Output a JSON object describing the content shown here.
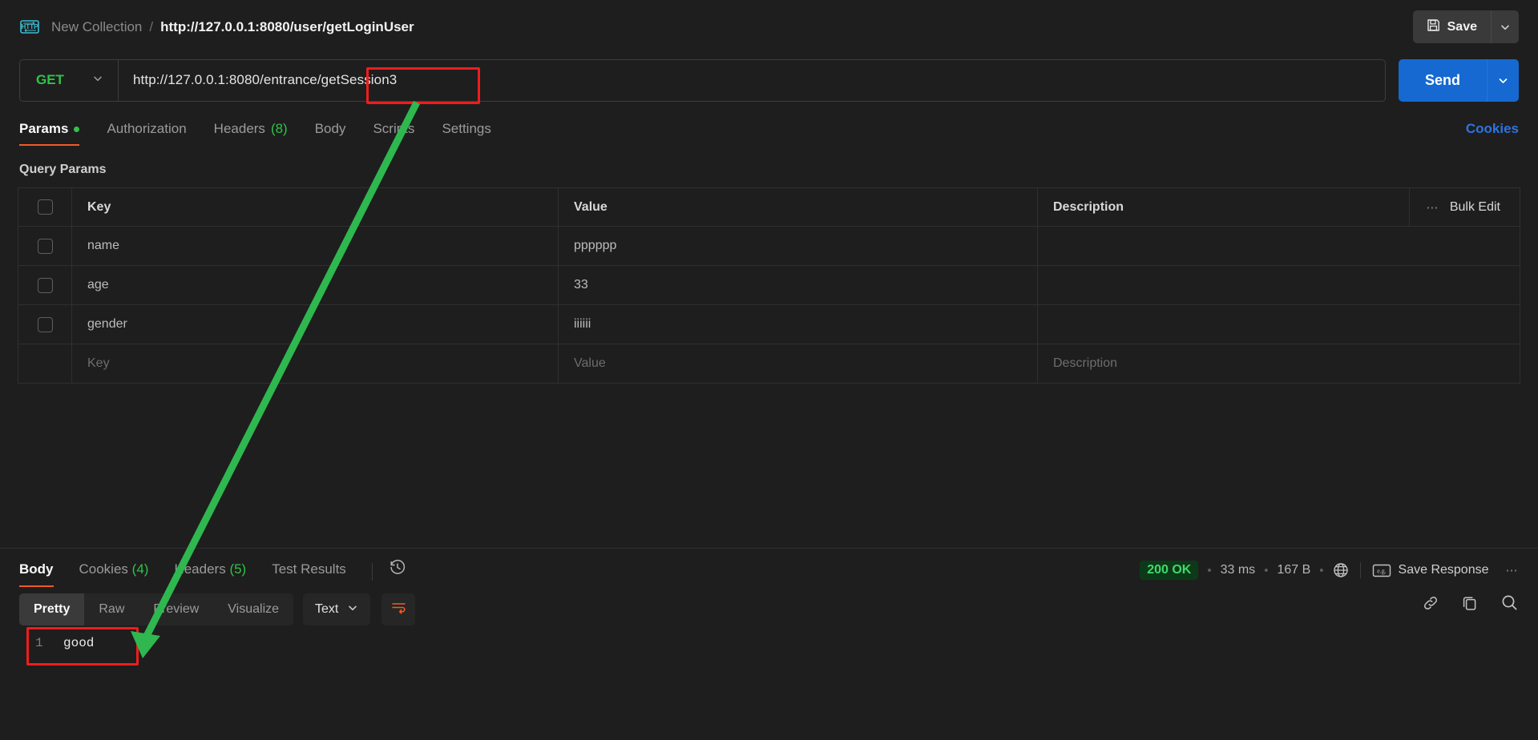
{
  "app": {
    "breadcrumb": {
      "collection": "New Collection",
      "separator": "/",
      "current": "http://127.0.0.1:8080/user/getLoginUser"
    },
    "save_label": "Save"
  },
  "request": {
    "method": "GET",
    "url": "http://127.0.0.1:8080/entrance/getSession3",
    "send_label": "Send",
    "tabs": [
      {
        "label": "Params",
        "active": true,
        "dot": true
      },
      {
        "label": "Authorization",
        "active": false
      },
      {
        "label": "Headers",
        "count": "(8)",
        "active": false
      },
      {
        "label": "Body",
        "active": false
      },
      {
        "label": "Scripts",
        "active": false
      },
      {
        "label": "Settings",
        "active": false
      }
    ],
    "cookies_link": "Cookies"
  },
  "query_params": {
    "title": "Query Params",
    "columns": {
      "key": "Key",
      "value": "Value",
      "description": "Description"
    },
    "bulk_edit": "Bulk Edit",
    "rows": [
      {
        "key": "name",
        "value": "pppppp",
        "description": ""
      },
      {
        "key": "age",
        "value": "33",
        "description": ""
      },
      {
        "key": "gender",
        "value": "iiiiii",
        "description": ""
      }
    ],
    "placeholder_row": {
      "key": "Key",
      "value": "Value",
      "description": "Description"
    }
  },
  "response": {
    "tabs": [
      {
        "label": "Body",
        "active": true
      },
      {
        "label": "Cookies",
        "count": "(4)",
        "active": false
      },
      {
        "label": "Headers",
        "count": "(5)",
        "active": false
      },
      {
        "label": "Test Results",
        "active": false
      }
    ],
    "status": "200 OK",
    "time": "33 ms",
    "size": "167 B",
    "save_response": "Save Response",
    "format_tabs": [
      {
        "label": "Pretty",
        "active": true
      },
      {
        "label": "Raw",
        "active": false
      },
      {
        "label": "Preview",
        "active": false
      },
      {
        "label": "Visualize",
        "active": false
      }
    ],
    "content_type": "Text",
    "body_lines": [
      {
        "number": "1",
        "text": "good"
      }
    ]
  },
  "colors": {
    "accent_orange": "#ef5b25",
    "method_green": "#30c24a",
    "send_blue": "#1569d1",
    "link_blue": "#2d74e0",
    "status_green": "#43d86a",
    "annotation_red": "#f01c1c",
    "annotation_green": "#2eb84f"
  }
}
